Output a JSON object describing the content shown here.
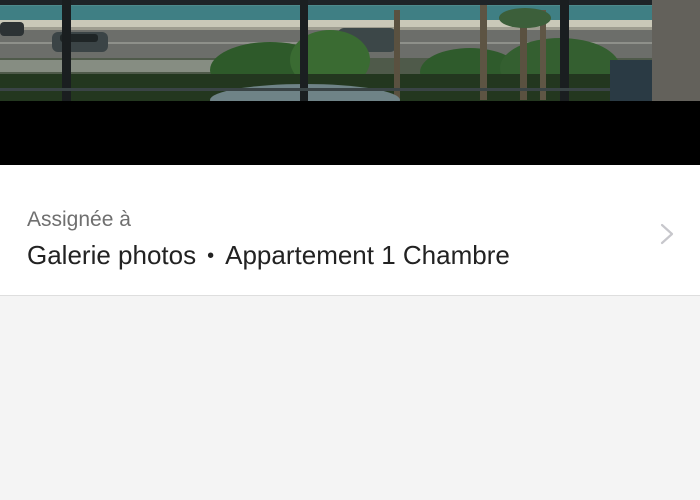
{
  "photo": {
    "icon": "balcony-sea-view-photo"
  },
  "assignment": {
    "label": "Assignée à",
    "album": "Galerie photos",
    "separator": "•",
    "target": "Appartement 1 Chambre",
    "chevron_icon": "chevron-right-icon"
  },
  "colors": {
    "row_background": "#ffffff",
    "page_background": "#f4f4f4",
    "label_text": "#6f6f6f",
    "value_text": "#222222",
    "chevron": "#c7c7cc"
  }
}
